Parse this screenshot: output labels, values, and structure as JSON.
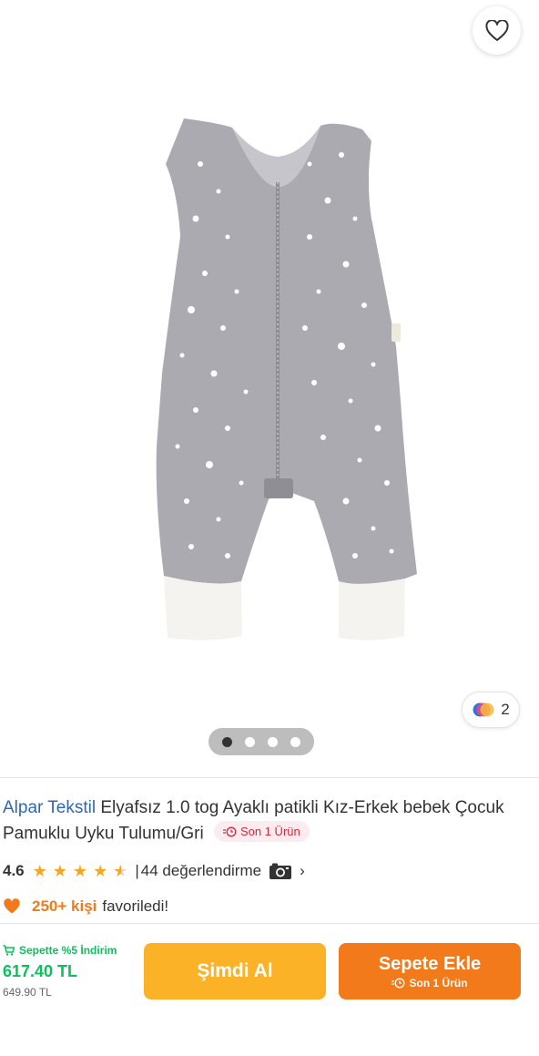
{
  "gallery": {
    "favorite_icon": "heart-outline-icon",
    "variant_count": "2",
    "variant_icon": "color-swatch-icon",
    "slide_count": 4,
    "active_slide": 1
  },
  "product": {
    "brand": "Alpar Tekstil",
    "title": "Elyafsız 1.0 tog Ayaklı patikli Kız-Erkek bebek Çocuk Pamuklu Uyku Tulumu/Gri",
    "stock_badge": "Son 1 Ürün",
    "stock_icon": "clock-icon"
  },
  "rating": {
    "score": "4.6",
    "stars": 4.6,
    "separator": "|",
    "reviews_text": "44 değerlendirme",
    "camera_icon": "camera-icon",
    "chevron": "›"
  },
  "favorites": {
    "icon": "heart-icon",
    "count": "250+ kişi",
    "text": "favoriledi!"
  },
  "bottom_bar": {
    "discount_label": "Sepette %5 İndirim",
    "price": "617.40 TL",
    "old_price": "649.90 TL",
    "buy_now_label": "Şimdi Al",
    "add_to_cart_label": "Sepete Ekle",
    "add_to_cart_sub": "Son 1 Ürün"
  },
  "colors": {
    "brand_blue": "#2e67b2",
    "orange": "#f27a1a",
    "yellow": "#fbb226",
    "green": "#0bc15c",
    "star": "#f6a623",
    "badge_red": "#d72638"
  }
}
